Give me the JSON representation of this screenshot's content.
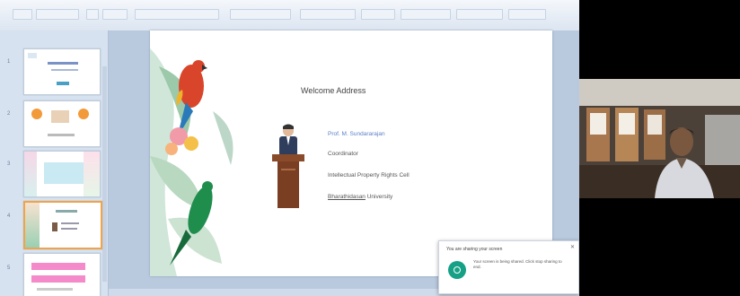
{
  "slide": {
    "title": "Welcome Address",
    "speaker_name": "Prof. M. Sundararajan",
    "speaker_role": "Coordinator",
    "speaker_dept": "Intellectual Property Rights Cell",
    "speaker_univ_underlined": "Bharathidasan",
    "speaker_univ_rest": " University"
  },
  "thumbnails": [
    "1",
    "2",
    "3",
    "4",
    "5"
  ],
  "notification": {
    "title": "You are sharing your screen",
    "body": "Your screen is being shared. Click stop sharing to end.",
    "footer": ""
  },
  "colors": {
    "ribbon": "#dce5f1",
    "stage": "#b9c9de",
    "accent_selected": "#f0a34a",
    "toast_icon": "#16a085"
  }
}
